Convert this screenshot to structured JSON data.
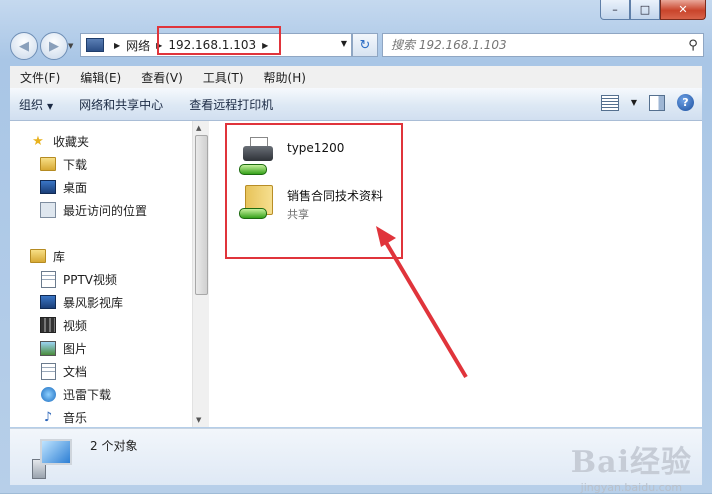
{
  "window": {
    "caption": {
      "minimize": "–",
      "maximize": "□",
      "close": "✕"
    }
  },
  "address": {
    "crumbs": [
      "网络",
      "192.168.1.103"
    ],
    "search_placeholder": "搜索 192.168.1.103"
  },
  "menu": [
    "文件(F)",
    "编辑(E)",
    "查看(V)",
    "工具(T)",
    "帮助(H)"
  ],
  "toolbar": {
    "organize": "组织",
    "network_center": "网络和共享中心",
    "remote_printers": "查看远程打印机"
  },
  "sidebar": {
    "favorites": {
      "label": "收藏夹",
      "icon": "star-icon"
    },
    "favorites_items": [
      {
        "label": "下载",
        "icon": "download-folder-icon"
      },
      {
        "label": "桌面",
        "icon": "desktop-icon"
      },
      {
        "label": "最近访问的位置",
        "icon": "recent-places-icon"
      }
    ],
    "library": {
      "label": "库",
      "icon": "library-icon"
    },
    "library_items": [
      {
        "label": "PPTV视频",
        "icon": "pptv-folder-icon"
      },
      {
        "label": "暴风影视库",
        "icon": "baofeng-library-icon"
      },
      {
        "label": "视频",
        "icon": "video-icon"
      },
      {
        "label": "图片",
        "icon": "pictures-icon"
      },
      {
        "label": "文档",
        "icon": "documents-icon"
      },
      {
        "label": "迅雷下载",
        "icon": "thunder-icon"
      },
      {
        "label": "音乐",
        "icon": "music-icon"
      }
    ]
  },
  "files": [
    {
      "name": "type1200",
      "sub": "",
      "icon": "shared-printer-icon"
    },
    {
      "name": "销售合同技术资料",
      "sub": "共享",
      "icon": "shared-folder-icon"
    }
  ],
  "status": {
    "text": "2 个对象",
    "icon": "computer-icon"
  },
  "watermark": {
    "logo": "Bai经验",
    "url": "jingyan.baidu.com"
  },
  "colors": {
    "highlight": "#e0343b",
    "accent": "#2b6cc4"
  }
}
